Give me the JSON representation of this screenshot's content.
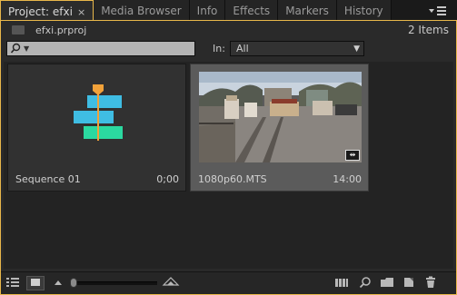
{
  "tabs": [
    {
      "label": "Project: efxi",
      "close": "×",
      "active": true
    },
    {
      "label": "Media Browser"
    },
    {
      "label": "Info"
    },
    {
      "label": "Effects"
    },
    {
      "label": "Markers"
    },
    {
      "label": "History"
    }
  ],
  "tab_menu_icon": "panel-menu-icon",
  "project": {
    "file_name": "efxi.prproj",
    "item_count": "2 Items"
  },
  "search": {
    "value": "",
    "placeholder": ""
  },
  "in_filter": {
    "label": "In:",
    "selected": "All"
  },
  "items": [
    {
      "name": "Sequence 01",
      "duration": "0;00",
      "type": "sequence"
    },
    {
      "name": "1080p60.MTS",
      "duration": "14:00",
      "type": "clip"
    }
  ],
  "colors": {
    "accent": "#e8b74a",
    "sequence_blue": "#3fbde3",
    "sequence_green": "#2bd9a0",
    "sequence_orange": "#f2a23a"
  },
  "zoom_slider": {
    "value_fraction": 0.0
  },
  "bottom_icons": [
    "list-view-icon",
    "icon-view-icon",
    "zoom-out-icon",
    "zoom-in-icon",
    "automate-to-sequence-icon",
    "find-icon",
    "new-bin-icon",
    "new-item-icon",
    "clear-icon"
  ]
}
